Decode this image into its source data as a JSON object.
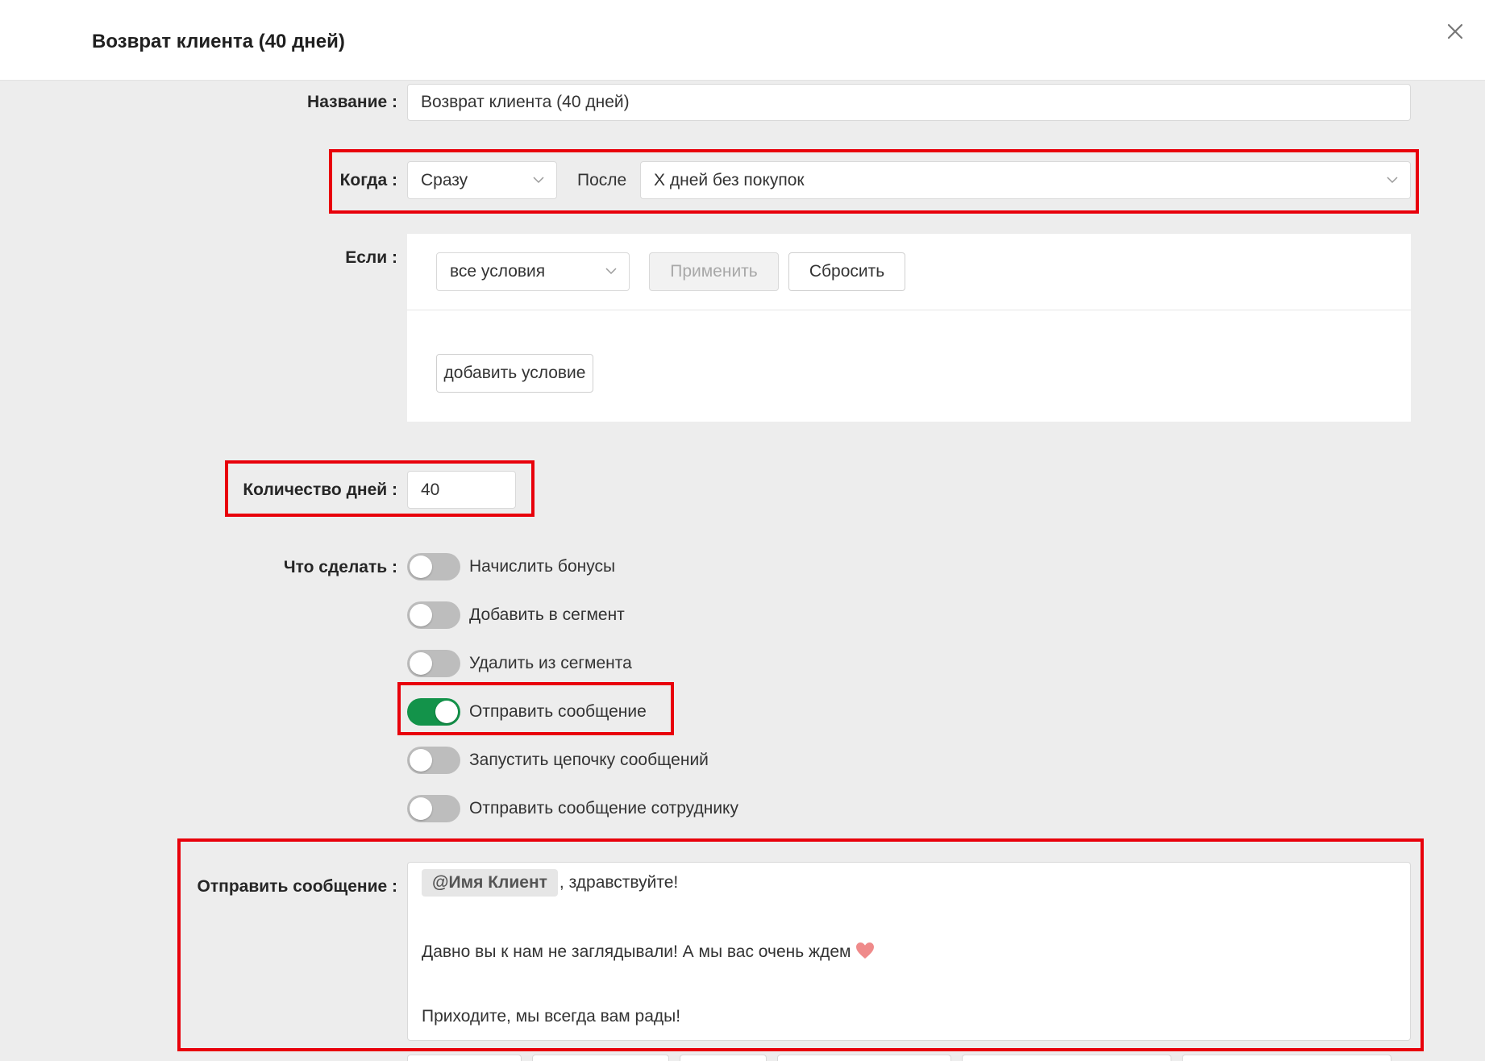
{
  "modal": {
    "title": "Возврат клиента (40 дней)"
  },
  "name_field": {
    "label": "Название :",
    "value": "Возврат клиента (40 дней)"
  },
  "when": {
    "label": "Когда :",
    "timing_select": "Сразу",
    "after_label": "После",
    "trigger_select": "X дней без покупок"
  },
  "if": {
    "label": "Если :",
    "conditions_select": "все условия",
    "apply_button": "Применить",
    "reset_button": "Сбросить",
    "add_condition_button": "добавить условие"
  },
  "days": {
    "label": "Количество дней :",
    "value": "40"
  },
  "actions": {
    "label": "Что сделать :",
    "items": [
      {
        "label": "Начислить бонусы",
        "enabled": false
      },
      {
        "label": "Добавить в сегмент",
        "enabled": false
      },
      {
        "label": "Удалить из сегмента",
        "enabled": false
      },
      {
        "label": "Отправить сообщение",
        "enabled": true
      },
      {
        "label": "Запустить цепочку сообщений",
        "enabled": false
      },
      {
        "label": "Отправить сообщение сотруднику",
        "enabled": false
      }
    ]
  },
  "send_message": {
    "label": "Отправить сообщение :",
    "chip": "@Имя Клиент",
    "line1_suffix": ", здравствуйте!",
    "line2": "Давно вы к нам не заглядывали! А мы вас очень ждем",
    "line2_icon": "heart-icon",
    "line3": "Приходите, мы всегда вам рады!"
  },
  "colors": {
    "toggle_on": "#13934a",
    "toggle_off": "#bdbdbd",
    "highlight": "#e8000b",
    "background": "#ededed"
  }
}
